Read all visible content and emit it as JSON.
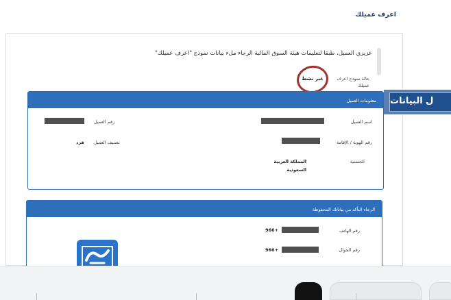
{
  "header": {
    "title": "اعرف عميلك"
  },
  "intro": {
    "text": "عزيزي العميل، طبقا لتعليمات هيئة السوق المالية الرجاء ملء بيانات نموذج \"اعرف عميلك\""
  },
  "status": {
    "label": "حالة نموذج اعرف عميلك",
    "value": "غير نشط"
  },
  "client_info": {
    "header": "معلومات العميل",
    "fields": {
      "client_name_label": "اسم العميل",
      "client_number_label": "رقم العميل",
      "id_label": "رقم الهوية / الإقامة",
      "classification_label": "تصنيف العميل",
      "classification_value": "فرد",
      "nationality_label": "الجنسية",
      "nationality_value": "المملكة العربية السعودية"
    }
  },
  "contact_info": {
    "header": "الرجاء التأكد من بياناتك المحفوظة",
    "fields": {
      "phone_label": "رقم الهاتف",
      "phone_prefix": "+966",
      "mobile_label": "رقم الجوال",
      "mobile_prefix": "+966"
    }
  },
  "overlay": {
    "text": "ل البيانات"
  },
  "colors": {
    "primary": "#2f6fba",
    "status_circle": "#a13232",
    "heading": "#1f3f77"
  }
}
